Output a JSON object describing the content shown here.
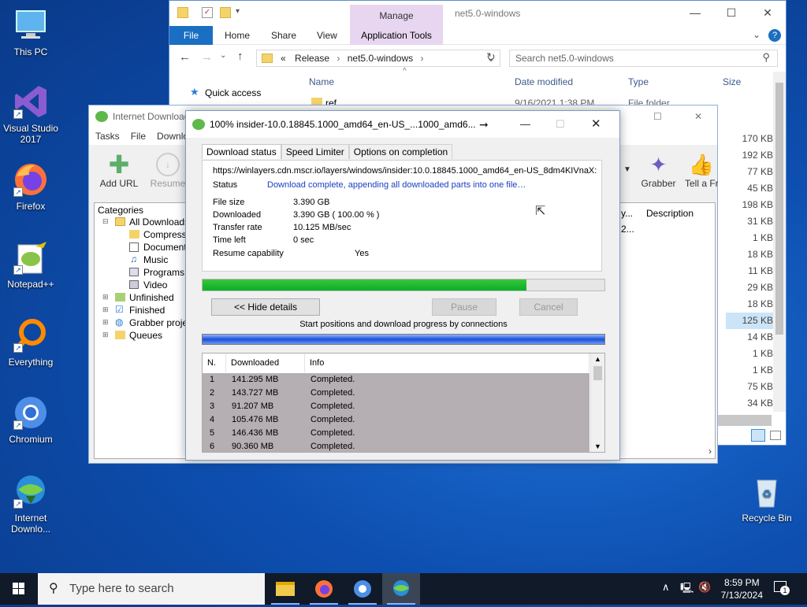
{
  "desktop": {
    "icons": [
      {
        "label": "This PC"
      },
      {
        "label": "Visual Studio 2017"
      },
      {
        "label": "Firefox"
      },
      {
        "label": "Notepad++"
      },
      {
        "label": "Everything"
      },
      {
        "label": "Chromium"
      },
      {
        "label": "Internet Downlo..."
      }
    ],
    "recycle_bin": "Recycle Bin"
  },
  "explorer": {
    "manage_tab": "Manage",
    "title": "net5.0-windows",
    "ribbon": {
      "file": "File",
      "home": "Home",
      "share": "Share",
      "view": "View",
      "app_tools": "Application Tools"
    },
    "breadcrumb": {
      "sep": "«",
      "part1": "Release",
      "part2": "net5.0-windows"
    },
    "search_placeholder": "Search net5.0-windows",
    "quick_access": "Quick access",
    "columns": {
      "name": "Name",
      "date": "Date modified",
      "type": "Type",
      "size": "Size"
    },
    "first_row": {
      "name": "ref",
      "date": "9/16/2021 1:38 PM",
      "type": "File folder"
    },
    "sizes": [
      "170 KB",
      "192 KB",
      "77 KB",
      "45 KB",
      "198 KB",
      "31 KB",
      "1 KB",
      "18 KB",
      "11 KB",
      "29 KB",
      "18 KB",
      "125 KB",
      "14 KB",
      "1 KB",
      "1 KB",
      "75 KB",
      "34 KB"
    ]
  },
  "idm": {
    "title": "Internet Download",
    "menu": {
      "tasks": "Tasks",
      "file": "File",
      "downloads": "Downlo"
    },
    "toolbar": {
      "add_url": "Add URL",
      "resume": "Resume",
      "grabber": "Grabber",
      "tell": "Tell a Fri"
    },
    "categories_title": "Categories",
    "categories": {
      "all": "All Downloads",
      "compressed": "Compresse",
      "documents": "Documents",
      "music": "Music",
      "programs": "Programs",
      "video": "Video",
      "unfinished": "Unfinished",
      "finished": "Finished",
      "grabber": "Grabber projec",
      "queues": "Queues"
    },
    "list_cols": {
      "col1": "y...",
      "desc": "Description"
    },
    "list_val": "2..."
  },
  "dialog": {
    "title": "100% insider-10.0.18845.1000_amd64_en-US_...1000_amd6...",
    "tabs": {
      "status": "Download status",
      "limiter": "Speed Limiter",
      "options": "Options on completion"
    },
    "url": "https://winlayers.cdn.mscr.io/layers/windows/insider:10.0.18845.1000_amd64_en-US_8dm4KIVnaX:",
    "status_label": "Status",
    "status_value": "Download complete, appending all downloaded parts into one file…",
    "file_size_label": "File size",
    "file_size_value": "3.390  GB",
    "downloaded_label": "Downloaded",
    "downloaded_value": "3.390  GB  ( 100.00 % )",
    "rate_label": "Transfer rate",
    "rate_value": "10.125  MB/sec",
    "time_left_label": "Time left",
    "time_left_value": "0 sec",
    "resume_label": "Resume capability",
    "resume_value": "Yes",
    "progress_fraction": 0.805,
    "hide_details": "<< Hide details",
    "pause": "Pause",
    "cancel": "Cancel",
    "connections_caption": "Start positions and download progress by connections",
    "table_headers": {
      "n": "N.",
      "downloaded": "Downloaded",
      "info": "Info"
    },
    "rows": [
      {
        "n": "1",
        "downloaded": "141.295  MB",
        "info": "Completed."
      },
      {
        "n": "2",
        "downloaded": "143.727  MB",
        "info": "Completed."
      },
      {
        "n": "3",
        "downloaded": "91.207  MB",
        "info": "Completed."
      },
      {
        "n": "4",
        "downloaded": "105.476  MB",
        "info": "Completed."
      },
      {
        "n": "5",
        "downloaded": "146.436  MB",
        "info": "Completed."
      },
      {
        "n": "6",
        "downloaded": "90.360  MB",
        "info": "Completed."
      }
    ]
  },
  "taskbar": {
    "search_placeholder": "Type here to search",
    "time": "8:59 PM",
    "date": "7/13/2024",
    "notification_count": "1"
  }
}
